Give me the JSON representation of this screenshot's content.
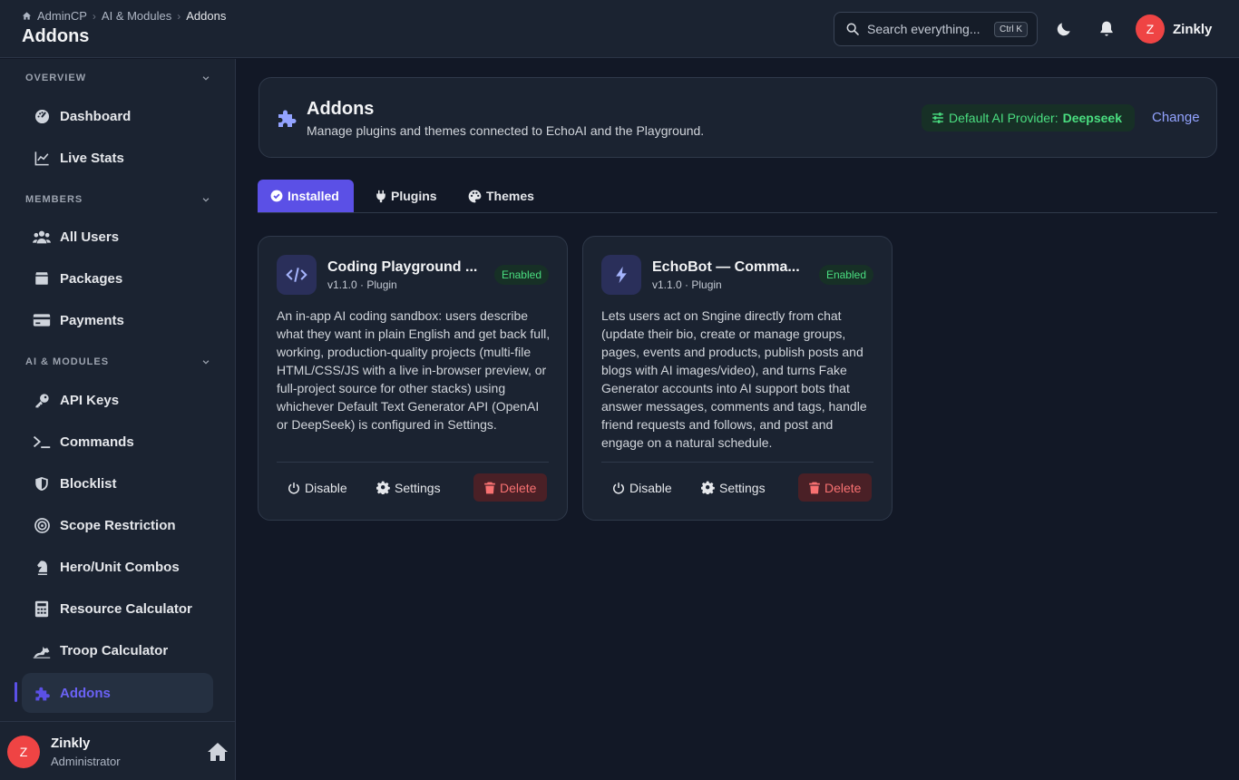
{
  "topbar": {
    "breadcrumb": [
      "AdminCP",
      "AI & Modules",
      "Addons"
    ],
    "page_title": "Addons",
    "search_placeholder": "Search everything...",
    "search_shortcut": "Ctrl K",
    "user_initial": "Z",
    "user_name": "Zinkly"
  },
  "sidebar": {
    "sections": [
      {
        "label": "OVERVIEW",
        "items": [
          {
            "label": "Dashboard",
            "icon": "dashboard-icon"
          },
          {
            "label": "Live Stats",
            "icon": "chart-line-icon"
          }
        ]
      },
      {
        "label": "MEMBERS",
        "items": [
          {
            "label": "All Users",
            "icon": "users-icon"
          },
          {
            "label": "Packages",
            "icon": "box-icon"
          },
          {
            "label": "Payments",
            "icon": "credit-card-icon"
          }
        ]
      },
      {
        "label": "AI & MODULES",
        "items": [
          {
            "label": "API Keys",
            "icon": "key-icon"
          },
          {
            "label": "Commands",
            "icon": "terminal-icon"
          },
          {
            "label": "Blocklist",
            "icon": "shield-icon"
          },
          {
            "label": "Scope Restriction",
            "icon": "target-icon"
          },
          {
            "label": "Hero/Unit Combos",
            "icon": "chess-knight-icon"
          },
          {
            "label": "Resource Calculator",
            "icon": "calculator-icon"
          },
          {
            "label": "Troop Calculator",
            "icon": "horse-icon"
          },
          {
            "label": "Addons",
            "icon": "puzzle-icon",
            "active": true
          }
        ]
      }
    ],
    "footer": {
      "initial": "Z",
      "name": "Zinkly",
      "role": "Administrator"
    }
  },
  "header": {
    "title": "Addons",
    "subtitle": "Manage plugins and themes connected to EchoAI and the Playground.",
    "provider_label": "Default AI Provider:",
    "provider_value": "Deepseek",
    "change_label": "Change"
  },
  "tabs": [
    {
      "label": "Installed",
      "active": true
    },
    {
      "label": "Plugins",
      "active": false
    },
    {
      "label": "Themes",
      "active": false
    }
  ],
  "addons": [
    {
      "title": "Coding Playground ...",
      "meta": "v1.1.0 · Plugin",
      "status": "Enabled",
      "description": "An in-app AI coding sandbox: users describe what they want in plain English and get back full, working, production-quality projects (multi-file HTML/CSS/JS with a live in-browser preview, or full-project source for other stacks) using whichever Default Text Generator API (OpenAI or DeepSeek) is configured in Settings.",
      "disable_label": "Disable",
      "settings_label": "Settings",
      "delete_label": "Delete"
    },
    {
      "title": "EchoBot — Comma...",
      "meta": "v1.1.0 · Plugin",
      "status": "Enabled",
      "description": "Lets users act on Sngine directly from chat (update their bio, create or manage groups, pages, events and products, publish posts and blogs with AI images/video), and turns Fake Generator accounts into AI support bots that answer messages, comments and tags, handle friend requests and follows, and post and engage on a natural schedule.",
      "disable_label": "Disable",
      "settings_label": "Settings",
      "delete_label": "Delete"
    }
  ],
  "colors": {
    "accent": "#5b50e6",
    "success": "#4ade80",
    "danger": "#f87171",
    "avatar": "#ef4444"
  }
}
